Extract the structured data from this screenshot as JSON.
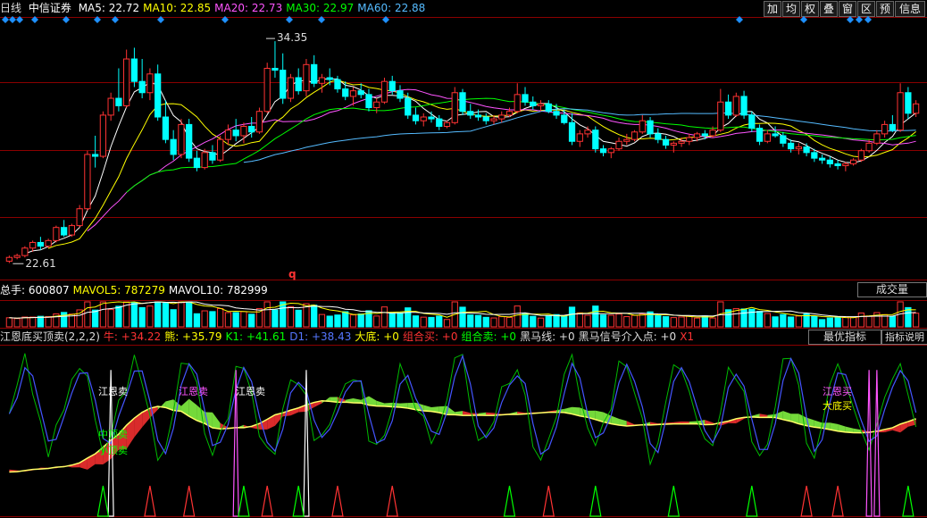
{
  "header": {
    "period": "日线",
    "stock": "中信证券",
    "ma": [
      {
        "label": "MA5:",
        "value": "22.72",
        "color": "#ffffff"
      },
      {
        "label": "MA10:",
        "value": "22.85",
        "color": "#ffff00"
      },
      {
        "label": "MA20:",
        "value": "22.73",
        "color": "#ff55ff"
      },
      {
        "label": "MA30:",
        "value": "22.97",
        "color": "#00ff00"
      },
      {
        "label": "MA60:",
        "value": "22.88",
        "color": "#55bbff"
      }
    ]
  },
  "toolbar": {
    "buttons": [
      "加",
      "均",
      "权",
      "叠",
      "窗",
      "区",
      "预",
      "信息"
    ]
  },
  "price_annotations": {
    "high": "34.35",
    "low": "22.61"
  },
  "markers": {
    "q": "q"
  },
  "volume": {
    "header": [
      {
        "label": "总手:",
        "value": "600807",
        "color": "#ffffff"
      },
      {
        "label": "MAVOL5:",
        "value": "787279",
        "color": "#ffff00"
      },
      {
        "label": "MAVOL10:",
        "value": "782999",
        "color": "#ffffff"
      }
    ],
    "button": "成交量"
  },
  "indicator": {
    "name": "江恩底买顶卖(2,2,2)",
    "fields": [
      {
        "label": "牛:",
        "value": "+34.22",
        "color": "#ff3333"
      },
      {
        "label": "熊:",
        "value": "+35.79",
        "color": "#ffff00"
      },
      {
        "label": "K1:",
        "value": "+41.61",
        "color": "#00ff00"
      },
      {
        "label": "D1:",
        "value": "+38.43",
        "color": "#5577ff"
      },
      {
        "label": "大底:",
        "value": "+0",
        "color": "#ffff00"
      },
      {
        "label": "组合买:",
        "value": "+0",
        "color": "#ff3333"
      },
      {
        "label": "组合卖:",
        "value": "+0",
        "color": "#00ff00"
      },
      {
        "label": "黑马线:",
        "value": "+0",
        "color": "#dddddd"
      },
      {
        "label": "黑马信号介入点:",
        "value": "+0",
        "color": "#dddddd"
      },
      {
        "label": "X1",
        "value": "",
        "color": "#ff3333"
      }
    ],
    "buttons": [
      "最优指标",
      "指标说明"
    ],
    "labels": [
      {
        "text": "江恩卖",
        "color": "#ffffff"
      },
      {
        "text": "江恩卖",
        "color": "#ff55ff"
      },
      {
        "text": "江恩卖",
        "color": "#ffffff"
      },
      {
        "text": "中顶卖",
        "color": "#00ff00"
      },
      {
        "text": "小顶卖",
        "color": "#00ff00"
      },
      {
        "text": "江恩买",
        "color": "#ff55ff"
      },
      {
        "text": "大底买",
        "color": "#ffff00"
      }
    ]
  },
  "colors": {
    "up": "#ff3333",
    "down": "#00ffff",
    "ma5": "#ffffff",
    "ma10": "#ffff00",
    "ma20": "#ff55ff",
    "ma30": "#00ff00",
    "ma60": "#55bbff",
    "grid": "#8a0000",
    "diamond": "#1e90ff"
  },
  "chart_data": {
    "type": "candlestick",
    "price_range": [
      22.0,
      35.5
    ],
    "candles": [
      [
        22.6,
        22.9,
        22.5,
        22.8
      ],
      [
        22.8,
        23.0,
        22.7,
        22.9
      ],
      [
        22.9,
        23.4,
        22.8,
        23.3
      ],
      [
        23.3,
        23.7,
        23.1,
        23.6
      ],
      [
        23.6,
        23.9,
        23.2,
        23.4
      ],
      [
        23.4,
        23.8,
        23.3,
        23.7
      ],
      [
        23.7,
        24.5,
        23.6,
        24.4
      ],
      [
        24.4,
        24.8,
        23.9,
        24.0
      ],
      [
        24.0,
        24.6,
        23.9,
        24.5
      ],
      [
        24.5,
        25.6,
        24.4,
        25.4
      ],
      [
        25.4,
        28.5,
        25.3,
        28.3
      ],
      [
        28.3,
        29.3,
        27.6,
        28.2
      ],
      [
        28.2,
        30.6,
        28.1,
        30.4
      ],
      [
        30.4,
        31.6,
        30.1,
        31.3
      ],
      [
        31.3,
        32.9,
        30.6,
        30.9
      ],
      [
        30.9,
        33.9,
        30.8,
        33.4
      ],
      [
        33.4,
        34.0,
        31.9,
        32.2
      ],
      [
        32.2,
        33.4,
        31.3,
        31.6
      ],
      [
        31.6,
        32.9,
        31.2,
        32.6
      ],
      [
        32.6,
        33.1,
        30.1,
        30.3
      ],
      [
        30.3,
        31.2,
        28.9,
        29.1
      ],
      [
        29.1,
        29.6,
        28.0,
        28.3
      ],
      [
        28.3,
        30.2,
        28.1,
        29.9
      ],
      [
        29.9,
        30.2,
        27.9,
        28.1
      ],
      [
        28.1,
        28.5,
        27.4,
        27.6
      ],
      [
        27.6,
        28.6,
        27.5,
        28.4
      ],
      [
        28.4,
        28.8,
        27.8,
        28.0
      ],
      [
        28.0,
        29.3,
        27.9,
        29.1
      ],
      [
        29.1,
        29.9,
        28.8,
        29.6
      ],
      [
        29.6,
        30.2,
        29.0,
        29.3
      ],
      [
        29.3,
        30.0,
        28.9,
        29.8
      ],
      [
        29.8,
        30.3,
        29.2,
        29.5
      ],
      [
        29.5,
        30.8,
        29.4,
        30.6
      ],
      [
        30.6,
        33.2,
        30.5,
        32.9
      ],
      [
        32.9,
        34.35,
        32.4,
        32.8
      ],
      [
        32.8,
        33.7,
        31.0,
        31.3
      ],
      [
        31.3,
        32.6,
        31.1,
        32.4
      ],
      [
        32.4,
        32.9,
        31.5,
        31.7
      ],
      [
        31.7,
        33.4,
        31.4,
        33.1
      ],
      [
        33.1,
        33.6,
        31.9,
        32.1
      ],
      [
        32.1,
        32.6,
        31.6,
        32.4
      ],
      [
        32.4,
        32.9,
        32.0,
        32.3
      ],
      [
        32.3,
        32.5,
        31.6,
        31.8
      ],
      [
        31.8,
        32.2,
        31.2,
        31.4
      ],
      [
        31.4,
        31.9,
        30.9,
        31.7
      ],
      [
        31.7,
        32.1,
        31.3,
        31.5
      ],
      [
        31.5,
        31.8,
        30.6,
        30.8
      ],
      [
        30.8,
        31.3,
        30.5,
        31.1
      ],
      [
        31.1,
        32.4,
        31.0,
        32.2
      ],
      [
        32.2,
        32.5,
        31.5,
        31.7
      ],
      [
        31.7,
        32.0,
        31.1,
        31.3
      ],
      [
        31.3,
        31.6,
        30.2,
        30.4
      ],
      [
        30.4,
        30.8,
        29.9,
        30.1
      ],
      [
        30.1,
        30.5,
        29.8,
        30.3
      ],
      [
        30.3,
        30.6,
        30.0,
        30.2
      ],
      [
        30.2,
        30.4,
        29.6,
        29.8
      ],
      [
        29.8,
        30.1,
        29.7,
        30.0
      ],
      [
        30.0,
        31.9,
        29.9,
        31.6
      ],
      [
        31.6,
        31.8,
        30.4,
        30.6
      ],
      [
        30.6,
        31.0,
        30.2,
        30.4
      ],
      [
        30.4,
        30.7,
        30.1,
        30.3
      ],
      [
        30.3,
        30.5,
        29.9,
        30.1
      ],
      [
        30.1,
        30.4,
        29.9,
        30.2
      ],
      [
        30.2,
        30.6,
        30.0,
        30.4
      ],
      [
        30.4,
        30.8,
        30.3,
        30.6
      ],
      [
        30.6,
        32.1,
        30.5,
        31.5
      ],
      [
        31.5,
        31.9,
        30.9,
        31.1
      ],
      [
        31.1,
        31.4,
        30.7,
        30.9
      ],
      [
        30.9,
        31.2,
        30.6,
        31.0
      ],
      [
        31.0,
        31.2,
        30.5,
        30.6
      ],
      [
        30.6,
        31.0,
        30.2,
        30.4
      ],
      [
        30.4,
        30.7,
        29.9,
        30.0
      ],
      [
        30.0,
        30.5,
        28.8,
        29.0
      ],
      [
        29.0,
        29.6,
        28.7,
        29.4
      ],
      [
        29.4,
        29.8,
        29.2,
        29.6
      ],
      [
        29.6,
        29.8,
        28.4,
        28.6
      ],
      [
        28.6,
        28.8,
        28.2,
        28.4
      ],
      [
        28.4,
        28.7,
        28.1,
        28.6
      ],
      [
        28.6,
        29.2,
        28.5,
        29.0
      ],
      [
        29.0,
        29.4,
        28.8,
        29.1
      ],
      [
        29.1,
        29.6,
        29.0,
        29.5
      ],
      [
        29.5,
        30.4,
        29.4,
        30.1
      ],
      [
        30.1,
        30.3,
        29.2,
        29.4
      ],
      [
        29.4,
        29.7,
        28.9,
        29.1
      ],
      [
        29.1,
        29.3,
        28.6,
        28.8
      ],
      [
        28.8,
        29.0,
        28.4,
        28.9
      ],
      [
        28.9,
        29.2,
        28.7,
        29.0
      ],
      [
        29.0,
        29.4,
        28.8,
        29.2
      ],
      [
        29.2,
        29.5,
        29.0,
        29.4
      ],
      [
        29.4,
        29.6,
        29.1,
        29.3
      ],
      [
        29.3,
        29.8,
        29.2,
        29.6
      ],
      [
        29.6,
        31.8,
        29.5,
        31.1
      ],
      [
        31.1,
        31.5,
        30.2,
        30.4
      ],
      [
        30.4,
        31.6,
        30.3,
        31.4
      ],
      [
        31.4,
        31.7,
        30.2,
        30.4
      ],
      [
        30.4,
        30.6,
        29.5,
        29.7
      ],
      [
        29.7,
        29.9,
        28.8,
        29.0
      ],
      [
        29.0,
        29.6,
        28.9,
        29.4
      ],
      [
        29.4,
        29.8,
        29.2,
        29.3
      ],
      [
        29.3,
        29.5,
        28.7,
        28.9
      ],
      [
        28.9,
        29.1,
        28.4,
        28.6
      ],
      [
        28.6,
        28.9,
        28.3,
        28.7
      ],
      [
        28.7,
        28.9,
        28.2,
        28.4
      ],
      [
        28.4,
        28.6,
        27.9,
        28.1
      ],
      [
        28.1,
        28.3,
        27.8,
        28.0
      ],
      [
        28.0,
        28.2,
        27.6,
        27.8
      ],
      [
        27.8,
        28.0,
        27.5,
        27.7
      ],
      [
        27.7,
        27.9,
        27.4,
        27.8
      ],
      [
        27.8,
        28.1,
        27.7,
        28.0
      ],
      [
        28.0,
        28.6,
        27.9,
        28.5
      ],
      [
        28.5,
        29.1,
        28.4,
        28.9
      ],
      [
        28.9,
        29.6,
        28.8,
        29.4
      ],
      [
        29.4,
        30.1,
        29.2,
        29.9
      ],
      [
        29.9,
        30.4,
        29.5,
        29.6
      ],
      [
        29.6,
        32.1,
        29.5,
        31.6
      ],
      [
        31.6,
        31.9,
        30.2,
        30.5
      ],
      [
        30.5,
        31.2,
        30.3,
        31.0
      ]
    ],
    "volume_axis_max": 1.6,
    "indicator_range": [
      0,
      100
    ]
  }
}
